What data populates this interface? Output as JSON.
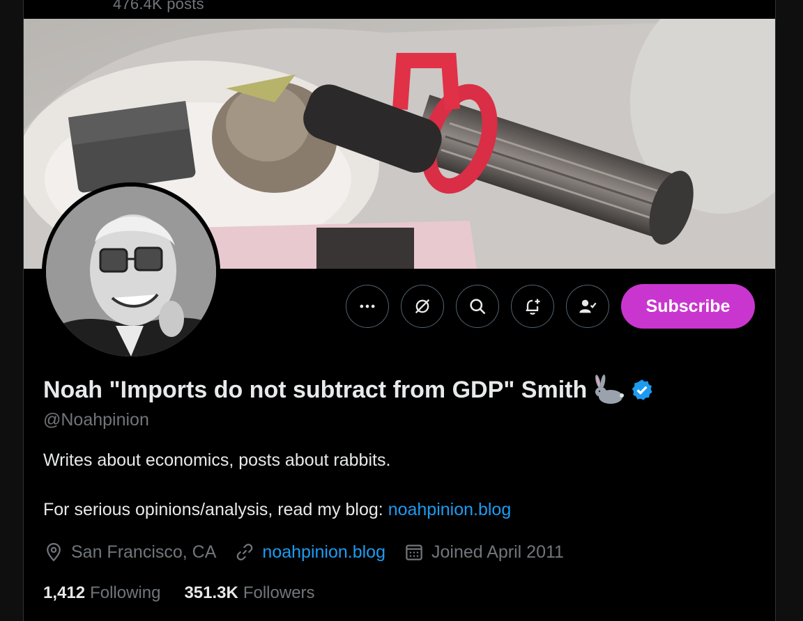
{
  "header": {
    "post_count": "476.4K posts"
  },
  "profile": {
    "display_name": "Noah \"Imports do not subtract from GDP\" Smith",
    "handle": "@Noahpinion",
    "bio_line1": "Writes about economics, posts about rabbits.",
    "bio_line2_prefix": "For serious opinions/analysis, read my blog: ",
    "bio_link": "noahpinion.blog",
    "location": "San Francisco, CA",
    "website": "noahpinion.blog",
    "joined": "Joined April 2011",
    "following_count": "1,412",
    "following_label": "Following",
    "followers_count": "351.3K",
    "followers_label": "Followers"
  },
  "actions": {
    "subscribe_label": "Subscribe",
    "icons": [
      "more-icon",
      "grok-icon",
      "search-icon",
      "notification-add-icon",
      "following-check-icon"
    ]
  },
  "colors": {
    "background": "#000000",
    "subscribe": "#c936cf",
    "link": "#1d9bf0",
    "verified": "#1d9bf0",
    "muted_text": "#71767b",
    "primary_text": "#e7e9ea"
  }
}
